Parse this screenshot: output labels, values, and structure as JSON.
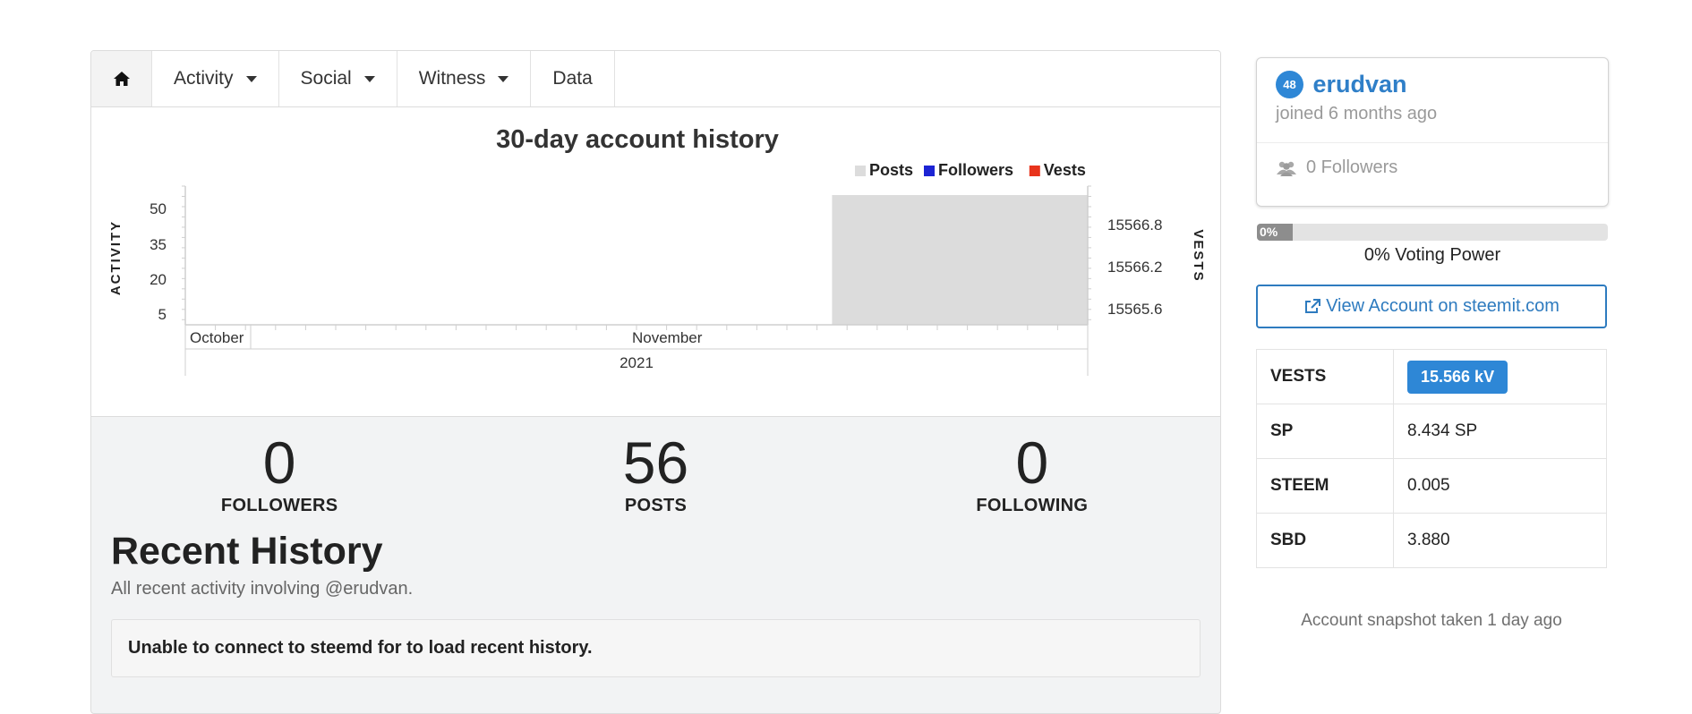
{
  "nav": {
    "tabs": [
      {
        "label": "Activity",
        "has_caret": true
      },
      {
        "label": "Social",
        "has_caret": true
      },
      {
        "label": "Witness",
        "has_caret": true
      },
      {
        "label": "Data",
        "has_caret": false
      }
    ],
    "home_icon": "home-icon"
  },
  "chart_data": {
    "type": "bar",
    "title": "30-day account history",
    "legend": [
      {
        "name": "Posts",
        "color": "#dcdcdc"
      },
      {
        "name": "Followers",
        "color": "#1c24d4"
      },
      {
        "name": "Vests",
        "color": "#e8341c"
      }
    ],
    "legend_position": "top-right",
    "ylabel": "ACTIVITY",
    "y2label": "VESTS",
    "yticks": [
      "50",
      "35",
      "20",
      "5"
    ],
    "y2ticks": [
      "15566.8",
      "15566.2",
      "15565.6"
    ],
    "xticks": [
      "October",
      "November"
    ],
    "xyear": "2021",
    "x_range": [
      0,
      30
    ],
    "ylim": [
      0,
      56
    ],
    "series": [
      {
        "name": "Posts",
        "bars": [
          {
            "x_start": 21.5,
            "x_end": 30,
            "value": 56
          }
        ]
      }
    ]
  },
  "stats": [
    {
      "value": "0",
      "label": "FOLLOWERS"
    },
    {
      "value": "56",
      "label": "POSTS"
    },
    {
      "value": "0",
      "label": "FOLLOWING"
    }
  ],
  "history": {
    "title": "Recent History",
    "subtitle": "All recent activity involving @erudvan.",
    "alert": "Unable to connect to steemd for to load recent history."
  },
  "profile": {
    "reputation": "48",
    "username": "erudvan",
    "joined": "joined 6 months ago",
    "followers": "0 Followers"
  },
  "voting": {
    "percent_label": "0%",
    "text": "0% Voting Power"
  },
  "view_account": "View Account on steemit.com",
  "balances": [
    {
      "key": "VESTS",
      "value": "15.566 kV",
      "badge": true
    },
    {
      "key": "SP",
      "value": "8.434 SP",
      "badge": false
    },
    {
      "key": "STEEM",
      "value": "0.005",
      "badge": false
    },
    {
      "key": "SBD",
      "value": "3.880",
      "badge": false
    }
  ],
  "snapshot": "Account snapshot taken 1 day ago",
  "colors": {
    "accent": "#2e87d6",
    "link": "#2f7fc8"
  }
}
